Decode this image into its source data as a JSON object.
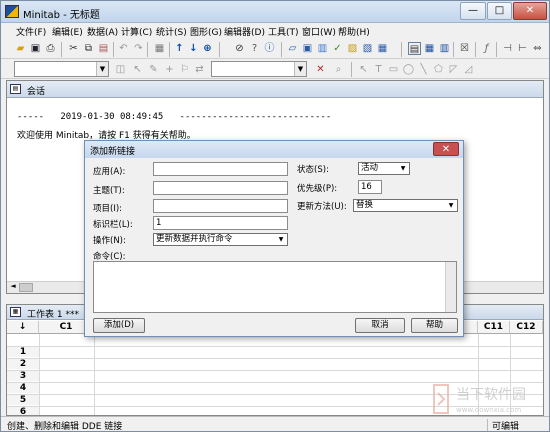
{
  "window": {
    "title": "Minitab - 无标题",
    "controls": [
      "—",
      "□",
      "✕"
    ]
  },
  "menu": [
    "文件(F)",
    "编辑(E)",
    "数据(A)",
    "计算(C)",
    "统计(S)",
    "图形(G)",
    "编辑器(D)",
    "工具(T)",
    "窗口(W)",
    "帮助(H)"
  ],
  "toolbar1": {
    "icons": [
      "open-icon",
      "save-icon",
      "print-icon",
      "cut-icon",
      "copy-icon",
      "paste-icon",
      "undo-icon",
      "redo-icon",
      "worksheet-icon",
      "up-arrow-icon",
      "down-arrow-icon",
      "binoculars-icon",
      "cancel-icon",
      "help-icon",
      "info-icon",
      "session-icon",
      "graph-folder-icon",
      "graph-icon",
      "report-icon",
      "project-icon",
      "layout-icon",
      "data-icon",
      "chart-icon",
      "formula-icon",
      "align-icon",
      "distribute-icon"
    ]
  },
  "toolbar2": {
    "combo1": "",
    "combo2": ""
  },
  "session": {
    "title": "会话",
    "timestamp_line": "-----   2019-01-30 08:49:45   ----------------------------",
    "welcome": "欢迎使用 Minitab，请按 F1 获得有关帮助。"
  },
  "worksheet": {
    "title": "工作表 1 ***",
    "corner": "↓",
    "columns": [
      "C1",
      "C11",
      "C12"
    ],
    "rows": [
      "1",
      "2",
      "3",
      "4",
      "5",
      "6"
    ]
  },
  "status": {
    "left": "创建、删除和编辑 DDE 链接",
    "right": "可编辑"
  },
  "dialog": {
    "title": "添加新链接",
    "app_label": "应用(A):",
    "app_value": "",
    "topic_label": "主题(T):",
    "topic_value": "",
    "item_label": "项目(I):",
    "item_value": "",
    "tag_label": "标识栏(L):",
    "tag_value": "1",
    "action_label": "操作(N):",
    "action_value": "更新数据并执行命令",
    "status_label": "状态(S):",
    "status_value": "活动",
    "priority_label": "优先级(P):",
    "priority_value": "16",
    "update_label": "更新方法(U):",
    "update_value": "替换",
    "command_label": "命令(C):",
    "add_button": "添加(D)",
    "cancel_button": "取消",
    "help_button": "帮助"
  },
  "watermark": {
    "main": "当下软件园",
    "sub": "www.downxia.com"
  }
}
